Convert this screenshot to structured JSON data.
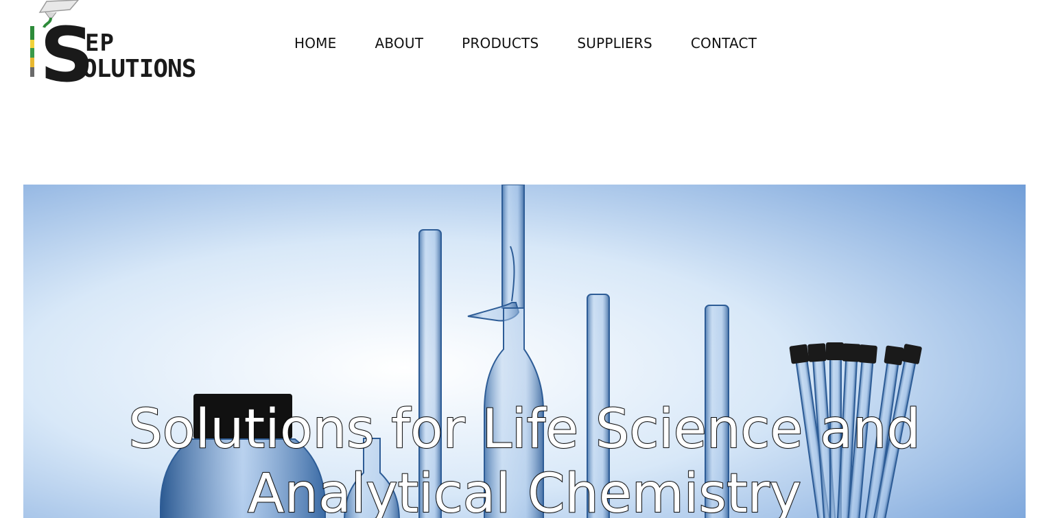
{
  "logo": {
    "text_top": "EP",
    "text_bottom": "OLUTIONS",
    "initial": "S"
  },
  "nav": {
    "items": [
      {
        "label": "HOME"
      },
      {
        "label": "ABOUT"
      },
      {
        "label": "PRODUCTS"
      },
      {
        "label": "SUPPLIERS"
      },
      {
        "label": "CONTACT"
      }
    ]
  },
  "hero": {
    "title": "Solutions for Life Science and Analytical Chemistry",
    "image": "laboratory-glassware"
  }
}
